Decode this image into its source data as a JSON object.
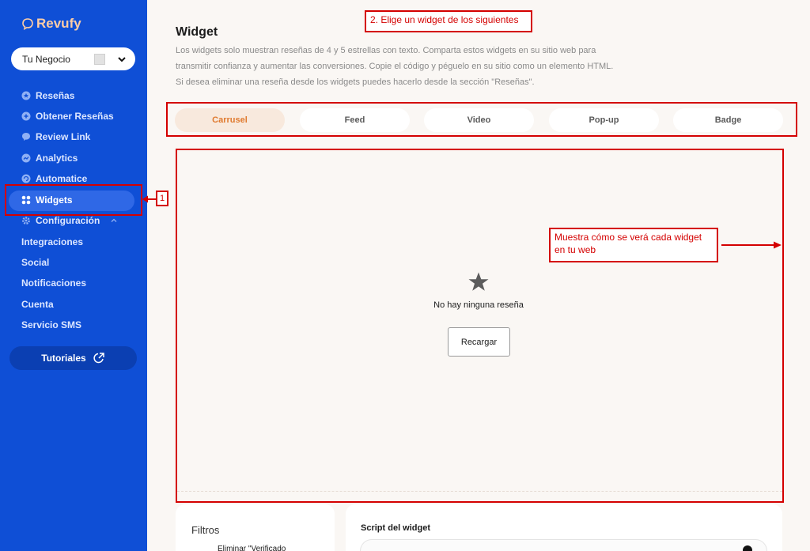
{
  "sidebar": {
    "brand": "Revufy",
    "business_selector": {
      "label": "Tu Negocio"
    },
    "items": [
      {
        "label": "Reseñas",
        "icon": "star-badge-icon"
      },
      {
        "label": "Obtener Reseñas",
        "icon": "plus-circle-icon"
      },
      {
        "label": "Review Link",
        "icon": "chat-bubble-icon"
      },
      {
        "label": "Analytics",
        "icon": "chart-circle-icon"
      },
      {
        "label": "Automatice",
        "icon": "automation-icon"
      },
      {
        "label": "Widgets",
        "icon": "grid-icon",
        "active": true
      },
      {
        "label": "Configuración",
        "icon": "gear-icon"
      },
      {
        "label": "Integraciones"
      },
      {
        "label": "Social"
      },
      {
        "label": "Notificaciones"
      },
      {
        "label": "Cuenta"
      },
      {
        "label": "Servicio SMS"
      }
    ],
    "tutorials_label": "Tutoriales"
  },
  "main": {
    "title": "Widget",
    "description": "Los widgets solo muestran reseñas de 4 y 5 estrellas con texto. Comparta estos widgets en su sitio web para transmitir confianza y aumentar las conversiones. Copie el código y péguelo en su sitio como un elemento HTML. Si desea eliminar una reseña desde los widgets puedes hacerlo desde la sección \"Reseñas\".",
    "tabs": [
      {
        "label": "Carrusel",
        "active": true
      },
      {
        "label": "Feed"
      },
      {
        "label": "Video"
      },
      {
        "label": "Pop-up"
      },
      {
        "label": "Badge"
      }
    ],
    "preview": {
      "empty_message": "No hay ninguna reseña",
      "reload_label": "Recargar"
    },
    "filters": {
      "title": "Filtros",
      "item": "Eliminar \"Verificado"
    },
    "script": {
      "title": "Script del widget"
    }
  },
  "annotations": {
    "step1": "1",
    "step2": "2. Elige un widget de los siguientes",
    "preview_note": "Muestra cómo se verá cada widget en tu web"
  },
  "colors": {
    "sidebar": "#0f4fd6",
    "accent": "#e07a2f",
    "annotation": "#d40000"
  }
}
